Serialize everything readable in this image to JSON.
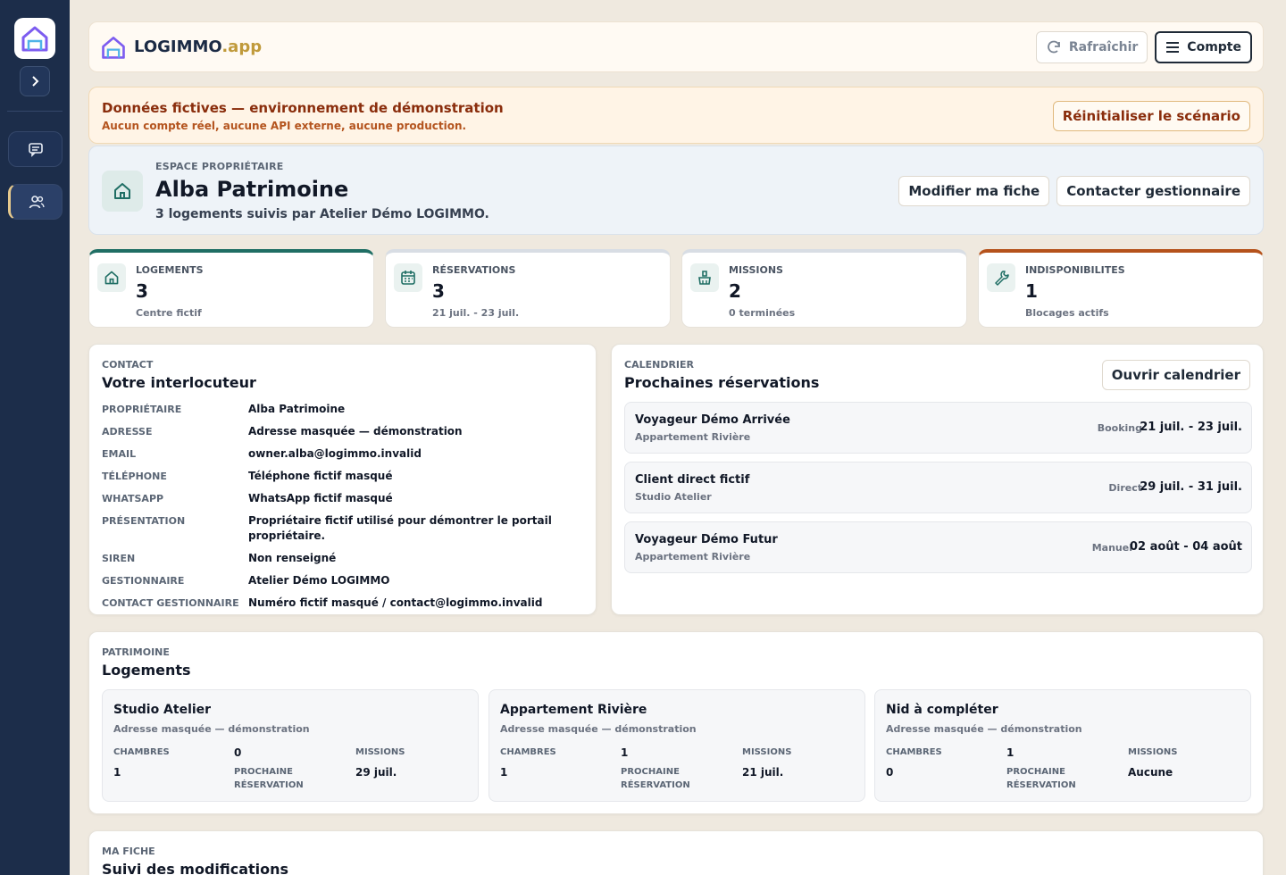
{
  "brand": {
    "name": "LOGIMMO",
    "suffix": ".app"
  },
  "topbar": {
    "refresh_label": "Rafraîchir",
    "account_label": "Compte"
  },
  "banner": {
    "title": "Données fictives — environnement de démonstration",
    "subtitle": "Aucun compte réel, aucune API externe, aucune production.",
    "reset_label": "Réinitialiser le scénario"
  },
  "owner": {
    "kicker": "ESPACE PROPRIÉTAIRE",
    "name": "Alba Patrimoine",
    "subtitle": "3 logements suivis par Atelier Démo LOGIMMO.",
    "edit_label": "Modifier ma fiche",
    "contact_label": "Contacter gestionnaire"
  },
  "stats": [
    {
      "label": "LOGEMENTS",
      "value": "3",
      "note": "Centre fictif",
      "icon": "home-icon"
    },
    {
      "label": "RÉSERVATIONS",
      "value": "3",
      "note": "21 juil. - 23 juil.",
      "icon": "calendar-icon"
    },
    {
      "label": "MISSIONS",
      "value": "2",
      "note": "0 terminées",
      "icon": "cleaning-icon"
    },
    {
      "label": "INDISPONIBILITES",
      "value": "1",
      "note": "Blocages actifs",
      "icon": "wrench-icon"
    }
  ],
  "contact": {
    "kicker": "CONTACT",
    "title": "Votre interlocuteur",
    "rows": [
      {
        "k": "PROPRIÉTAIRE",
        "v": "Alba Patrimoine"
      },
      {
        "k": "ADRESSE",
        "v": "Adresse masquée — démonstration"
      },
      {
        "k": "EMAIL",
        "v": "owner.alba@logimmo.invalid"
      },
      {
        "k": "TÉLÉPHONE",
        "v": "Téléphone fictif masqué"
      },
      {
        "k": "WHATSAPP",
        "v": "WhatsApp fictif masqué"
      },
      {
        "k": "PRÉSENTATION",
        "v": "Propriétaire fictif utilisé pour démontrer le portail propriétaire."
      },
      {
        "k": "SIREN",
        "v": "Non renseigné"
      },
      {
        "k": "GESTIONNAIRE",
        "v": "Atelier Démo LOGIMMO"
      },
      {
        "k": "CONTACT GESTIONNAIRE",
        "v": "Numéro fictif masqué / contact@logimmo.invalid"
      }
    ]
  },
  "calendar": {
    "kicker": "CALENDRIER",
    "title": "Prochaines réservations",
    "open_label": "Ouvrir calendrier",
    "items": [
      {
        "guest": "Voyageur Démo Arrivée",
        "property": "Appartement Rivière",
        "source": "Booking",
        "dates": "21 juil. - 23 juil."
      },
      {
        "guest": "Client direct fictif",
        "property": "Studio Atelier",
        "source": "Direct",
        "dates": "29 juil. - 31 juil."
      },
      {
        "guest": "Voyageur Démo Futur",
        "property": "Appartement Rivière",
        "source": "Manuel",
        "dates": "02 août - 04 août"
      }
    ]
  },
  "patrimoine": {
    "kicker": "PATRIMOINE",
    "title": "Logements",
    "labels": {
      "chambres": "CHAMBRES",
      "missions": "MISSIONS",
      "next1": "PROCHAINE",
      "next2": "RÉSERVATION"
    },
    "items": [
      {
        "name": "Studio Atelier",
        "address": "Adresse masquée — démonstration",
        "top_value": "0",
        "chambres": "1",
        "next": "29 juil."
      },
      {
        "name": "Appartement Rivière",
        "address": "Adresse masquée — démonstration",
        "top_value": "1",
        "chambres": "1",
        "next": "21 juil."
      },
      {
        "name": "Nid à compléter",
        "address": "Adresse masquée — démonstration",
        "top_value": "1",
        "chambres": "0",
        "next": "Aucune"
      }
    ]
  },
  "fiche": {
    "kicker": "MA FICHE",
    "title": "Suivi des modifications"
  },
  "colors": {
    "sidebar": "#1c2d4a",
    "accent_gold": "#c09a3b",
    "teal": "#1f6e64",
    "orange": "#b5521b",
    "banner_text": "#8a2d0c"
  }
}
